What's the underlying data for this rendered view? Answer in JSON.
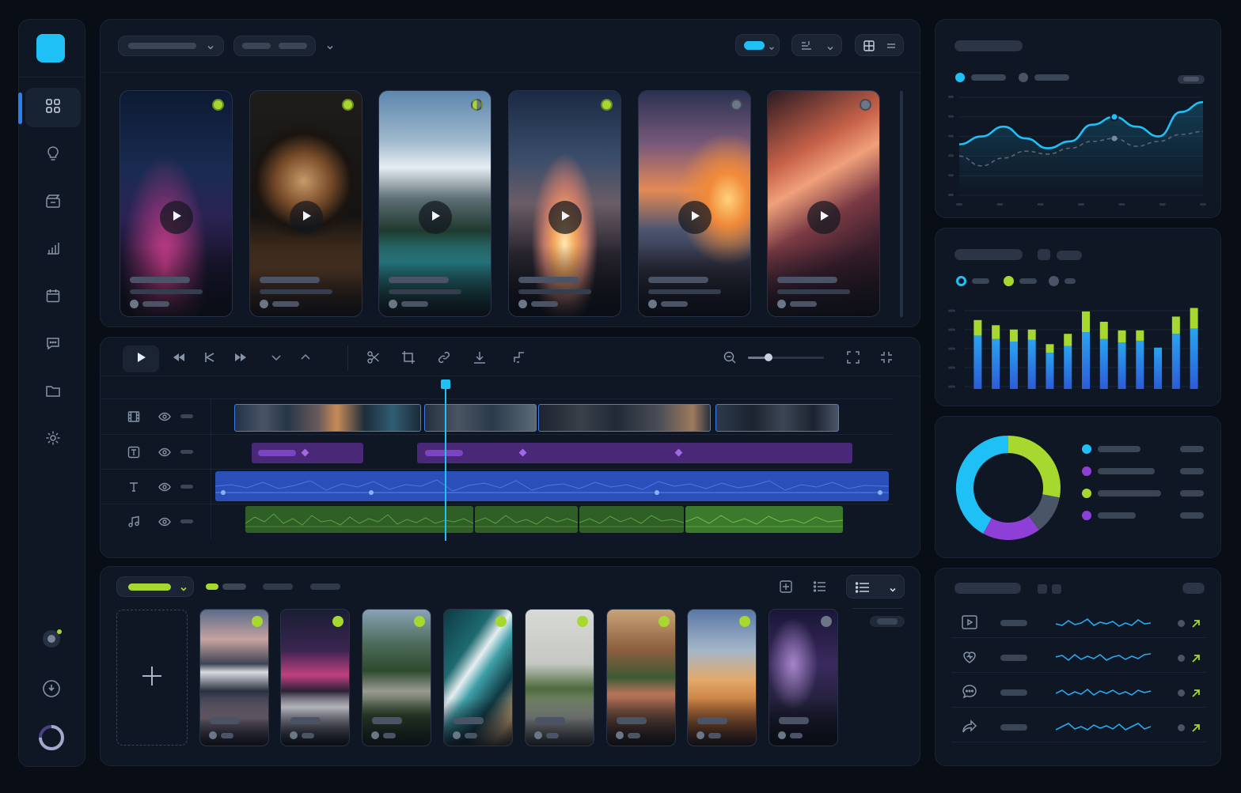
{
  "colors": {
    "background": "#080d16",
    "panel": "#0f1724",
    "accent_cyan": "#1ec0f5",
    "accent_lime": "#a6d830",
    "accent_purple": "#8e3fd8",
    "accent_blue": "#2c5ad6",
    "audio_green": "#3a7a2a"
  },
  "sidebar": {
    "logo": "app-logo",
    "items": [
      {
        "icon": "grid-icon",
        "active": true
      },
      {
        "icon": "lightbulb-icon",
        "active": false
      },
      {
        "icon": "clapperboard-icon",
        "active": false
      },
      {
        "icon": "bar-chart-icon",
        "active": false
      },
      {
        "icon": "calendar-icon",
        "active": false
      },
      {
        "icon": "chat-icon",
        "active": false
      },
      {
        "icon": "folder-icon",
        "active": false
      },
      {
        "icon": "settings-icon",
        "active": false
      }
    ],
    "bottom": [
      "status-dot-icon",
      "download-circle-icon",
      "progress-ring-icon"
    ]
  },
  "media_strip": {
    "cards": [
      {
        "scene": "neon-city-street",
        "status": "lime"
      },
      {
        "scene": "latte-cup",
        "status": "lime"
      },
      {
        "scene": "mountain-lake",
        "status": "half"
      },
      {
        "scene": "rocket-launch",
        "status": "lime"
      },
      {
        "scene": "ocean-sunset",
        "status": "gray"
      },
      {
        "scene": "canyon",
        "status": "gray"
      }
    ]
  },
  "timeline": {
    "tracks": [
      {
        "icon": "film-icon",
        "type": "video"
      },
      {
        "icon": "text-box-icon",
        "type": "title"
      },
      {
        "icon": "type-icon",
        "type": "voice"
      },
      {
        "icon": "music-icon",
        "type": "audio"
      }
    ],
    "toolbar": [
      "play-icon",
      "rewind-icon",
      "skip-back-icon",
      "fast-forward-icon",
      "chevron-down-icon",
      "chevron-up-icon",
      "scissors-icon",
      "crop-icon",
      "link-icon",
      "download-icon",
      "trim-icon",
      "zoom-out-icon",
      "fit-icon",
      "fullscreen-icon"
    ],
    "zoom_level": 0.15
  },
  "library": {
    "cards": [
      {
        "scene": "alpine-reflection",
        "status": "lime"
      },
      {
        "scene": "neon-crosswalk",
        "status": "lime"
      },
      {
        "scene": "forest-road",
        "status": "lime"
      },
      {
        "scene": "aerial-coast",
        "status": "lime"
      },
      {
        "scene": "plant",
        "status": "lime"
      },
      {
        "scene": "old-town-alley",
        "status": "lime"
      },
      {
        "scene": "desert-dunes",
        "status": "lime"
      },
      {
        "scene": "milky-way",
        "status": "gray"
      }
    ]
  },
  "stats": {
    "line_chart": {
      "series_a": [
        52,
        60,
        70,
        58,
        48,
        55,
        72,
        80,
        70,
        60,
        85,
        95
      ],
      "series_b": [
        40,
        30,
        38,
        45,
        42,
        48,
        55,
        58,
        50,
        55,
        62,
        65
      ]
    },
    "bar_chart": {
      "blue": [
        62,
        58,
        55,
        57,
        42,
        50,
        66,
        58,
        54,
        56,
        48,
        64,
        70
      ],
      "lime": [
        18,
        16,
        14,
        12,
        10,
        14,
        24,
        20,
        14,
        12,
        0,
        20,
        24
      ]
    },
    "donut": {
      "segments": [
        {
          "color": "#1ec0f5",
          "value": 42
        },
        {
          "color": "#8e3fd8",
          "value": 18
        },
        {
          "color": "#a6d830",
          "value": 28
        },
        {
          "color": "#4a5568",
          "value": 12
        }
      ]
    },
    "activity": [
      {
        "icon": "video-play-icon",
        "trend": "up"
      },
      {
        "icon": "heart-icon",
        "trend": "up"
      },
      {
        "icon": "comment-icon",
        "trend": "up"
      },
      {
        "icon": "share-icon",
        "trend": "up"
      }
    ]
  }
}
